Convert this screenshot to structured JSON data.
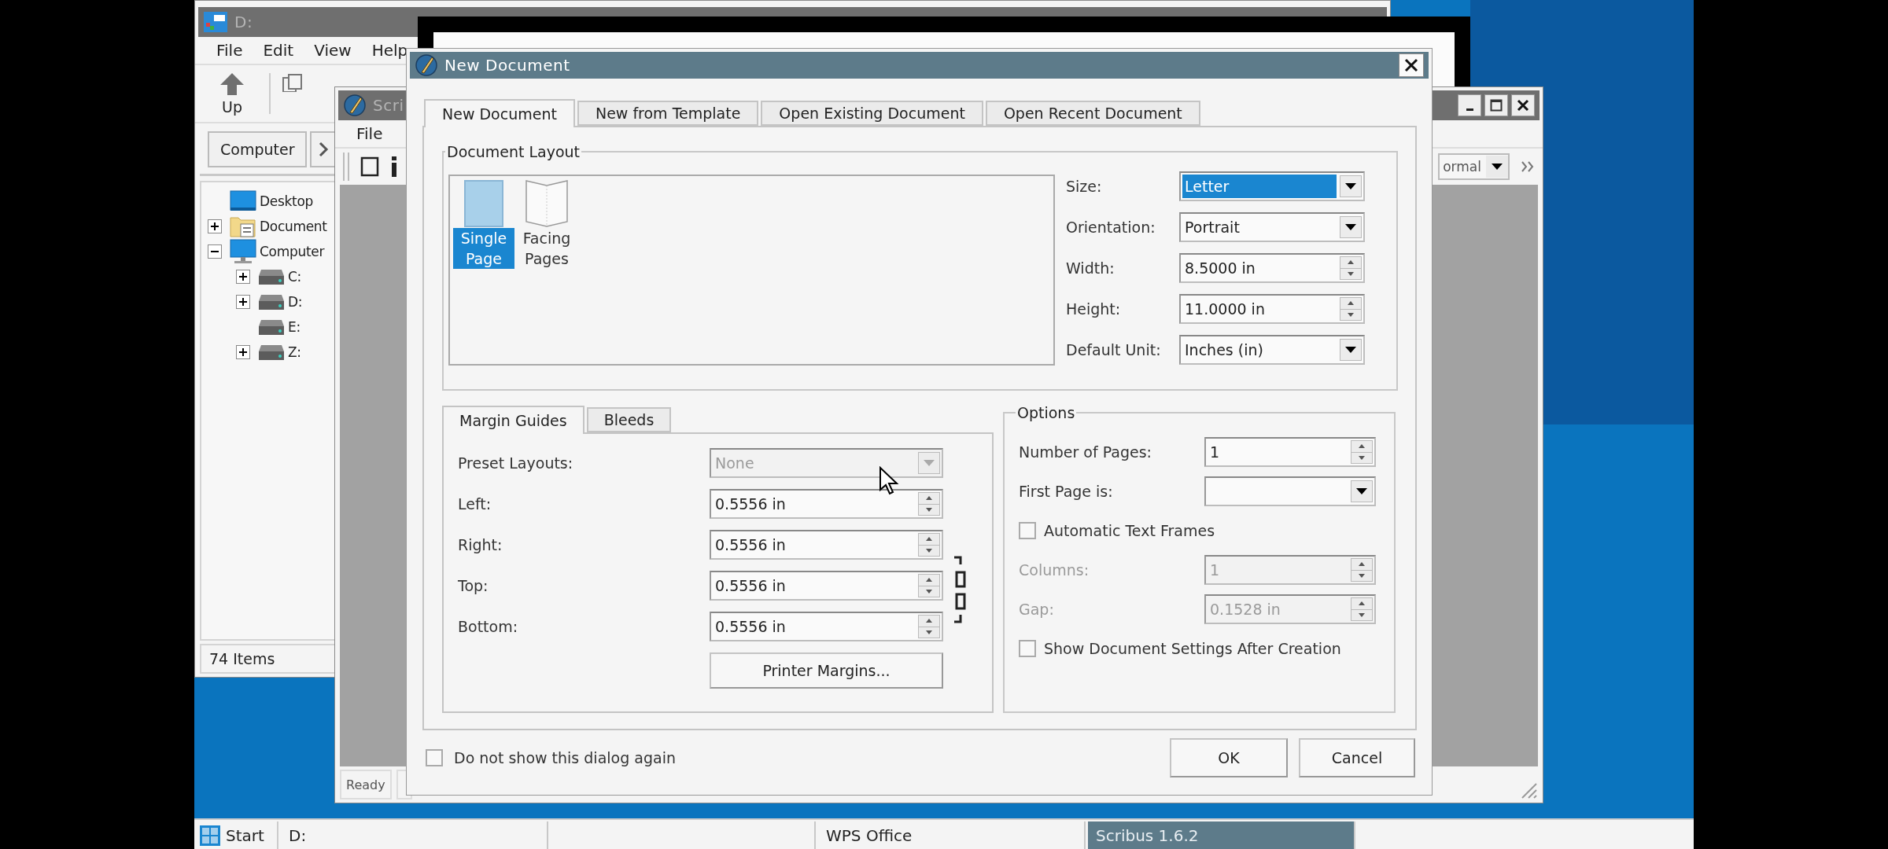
{
  "explorer": {
    "title": "D:",
    "menu": [
      "File",
      "Edit",
      "View",
      "Help"
    ],
    "toolbar": [
      {
        "label": "Up"
      }
    ],
    "path": [
      "Computer"
    ],
    "tree": [
      {
        "label": "Desktop",
        "kind": "desktop",
        "expandable": false
      },
      {
        "label": "Document",
        "kind": "documents",
        "expandable": true,
        "expanded": false
      },
      {
        "label": "Computer",
        "kind": "computer",
        "expandable": true,
        "expanded": true,
        "children": [
          {
            "label": "C:",
            "kind": "drive",
            "expandable": true,
            "expanded": false
          },
          {
            "label": "D:",
            "kind": "drive",
            "expandable": true,
            "expanded": false
          },
          {
            "label": "E:",
            "kind": "drive",
            "expandable": false
          },
          {
            "label": "Z:",
            "kind": "drive",
            "expandable": true,
            "expanded": false
          }
        ]
      }
    ],
    "status": "74 Items"
  },
  "scribus": {
    "title": "Scri",
    "menu": [
      "File"
    ],
    "style_value": "ormal",
    "status": "Ready"
  },
  "dialog": {
    "title": "New Document",
    "tabs": [
      {
        "label": "New Document",
        "selected": true
      },
      {
        "label": "New from Template",
        "selected": false
      },
      {
        "label": "Open Existing Document",
        "selected": false
      },
      {
        "label": "Open Recent Document",
        "selected": false
      }
    ],
    "layout": {
      "title": "Document Layout",
      "options": [
        {
          "label": "Single Page",
          "kind": "single",
          "selected": true
        },
        {
          "label": "Facing Pages",
          "kind": "facing",
          "selected": false
        }
      ],
      "fields": [
        {
          "label": "Size:",
          "kind": "combo",
          "value": "Letter",
          "highlighted": true
        },
        {
          "label": "Orientation:",
          "kind": "combo",
          "value": "Portrait",
          "highlighted": false
        },
        {
          "label": "Width:",
          "kind": "spin",
          "value": "8.5000 in",
          "highlighted": false
        },
        {
          "label": "Height:",
          "kind": "spin",
          "value": "11.0000 in",
          "highlighted": false
        },
        {
          "label": "Default Unit:",
          "kind": "combo",
          "value": "Inches (in)",
          "highlighted": false
        }
      ]
    },
    "margins": {
      "tabs": [
        {
          "label": "Margin Guides",
          "selected": true
        },
        {
          "label": "Bleeds",
          "selected": false
        }
      ],
      "rows": [
        {
          "label": "Preset Layouts:",
          "kind": "combo",
          "value": "None",
          "disabled": true
        },
        {
          "label": "Left:",
          "kind": "spin",
          "value": "0.5556 in",
          "disabled": false
        },
        {
          "label": "Right:",
          "kind": "spin",
          "value": "0.5556 in",
          "disabled": false
        },
        {
          "label": "Top:",
          "kind": "spin",
          "value": "0.5556 in",
          "disabled": false
        },
        {
          "label": "Bottom:",
          "kind": "spin",
          "value": "0.5556 in",
          "disabled": false
        }
      ],
      "button": "Printer Margins..."
    },
    "options": {
      "title": "Options",
      "rows": [
        {
          "kind": "spin",
          "label": "Number of Pages:",
          "value": "1",
          "disabled": false
        },
        {
          "kind": "combo",
          "label": "First Page is:",
          "disabled": false
        },
        {
          "kind": "checkbox",
          "label": "Automatic Text Frames",
          "checked": false,
          "disabled": false
        },
        {
          "kind": "spin",
          "label": "Columns:",
          "value": "1",
          "disabled": true
        },
        {
          "kind": "spin",
          "label": "Gap:",
          "value": "0.1528 in",
          "disabled": true
        },
        {
          "kind": "checkbox",
          "label": "Show Document Settings After Creation",
          "checked": false,
          "disabled": false
        }
      ]
    },
    "dont_show": {
      "label": "Do not show this dialog again",
      "checked": false
    },
    "buttons": [
      "OK",
      "Cancel"
    ]
  },
  "taskbar": {
    "start": "Start",
    "tasks": [
      {
        "kind": "window",
        "label": "D:",
        "selected": false
      },
      {
        "kind": "blank",
        "selected": false
      },
      {
        "kind": "window",
        "label": "WPS Office",
        "selected": false
      },
      {
        "kind": "window",
        "label": "Scribus 1.6.2",
        "selected": true
      }
    ]
  }
}
